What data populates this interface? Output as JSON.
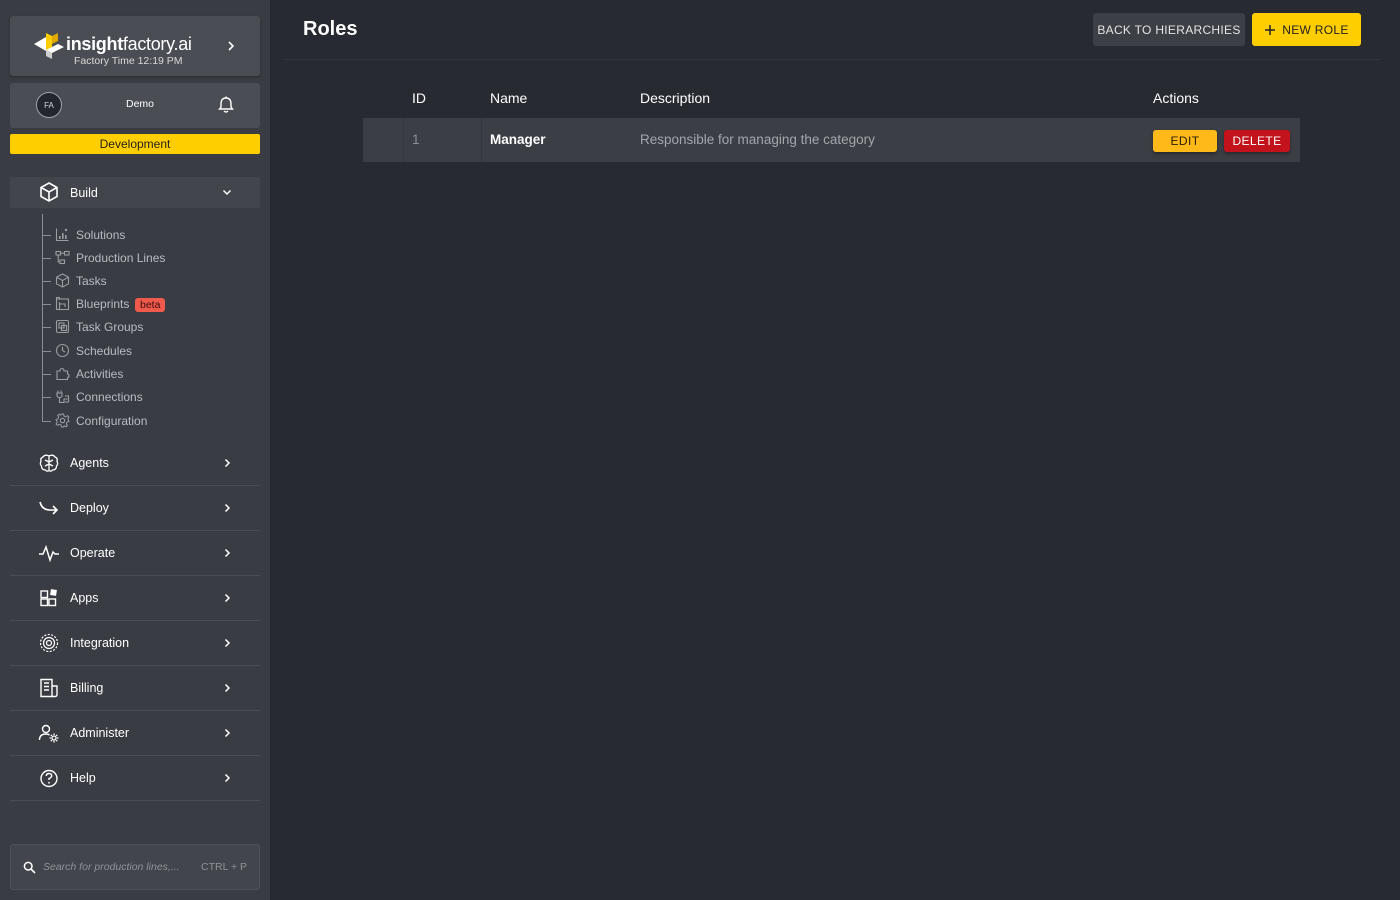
{
  "brand": {
    "name_bold": "insight",
    "name_light": "factory.ai",
    "time": "Factory Time 12:19 PM"
  },
  "user": {
    "initials": "FA",
    "name": "Demo"
  },
  "environment": "Development",
  "sidebar": {
    "build": {
      "label": "Build",
      "items": [
        {
          "label": "Solutions",
          "icon": "chart-icon"
        },
        {
          "label": "Production Lines",
          "icon": "flow-icon"
        },
        {
          "label": "Tasks",
          "icon": "cube-icon"
        },
        {
          "label": "Blueprints",
          "icon": "blueprint-icon",
          "badge": "beta"
        },
        {
          "label": "Task Groups",
          "icon": "group-icon"
        },
        {
          "label": "Schedules",
          "icon": "clock-icon"
        },
        {
          "label": "Activities",
          "icon": "puzzle-icon"
        },
        {
          "label": "Connections",
          "icon": "plug-icon"
        },
        {
          "label": "Configuration",
          "icon": "gear-icon"
        }
      ]
    },
    "sections": [
      {
        "label": "Agents",
        "icon": "brain-icon"
      },
      {
        "label": "Deploy",
        "icon": "deploy-arrow-icon"
      },
      {
        "label": "Operate",
        "icon": "pulse-icon"
      },
      {
        "label": "Apps",
        "icon": "apps-icon"
      },
      {
        "label": "Integration",
        "icon": "integration-icon"
      },
      {
        "label": "Billing",
        "icon": "billing-icon"
      },
      {
        "label": "Administer",
        "icon": "user-gear-icon"
      },
      {
        "label": "Help",
        "icon": "help-icon"
      }
    ]
  },
  "search": {
    "placeholder": "Search for production lines,...",
    "shortcut": "CTRL + P"
  },
  "page": {
    "title": "Roles",
    "back_button": "BACK TO HIERARCHIES",
    "new_button": "NEW ROLE"
  },
  "table": {
    "headers": {
      "id": "ID",
      "name": "Name",
      "description": "Description",
      "actions": "Actions"
    },
    "rows": [
      {
        "id": "1",
        "name": "Manager",
        "description": "Responsible for managing the category",
        "edit": "EDIT",
        "delete": "DELETE"
      }
    ]
  },
  "colors": {
    "accent": "#ffce00",
    "danger": "#c2121b",
    "background": "#272a31",
    "sidebar": "#393c42"
  }
}
